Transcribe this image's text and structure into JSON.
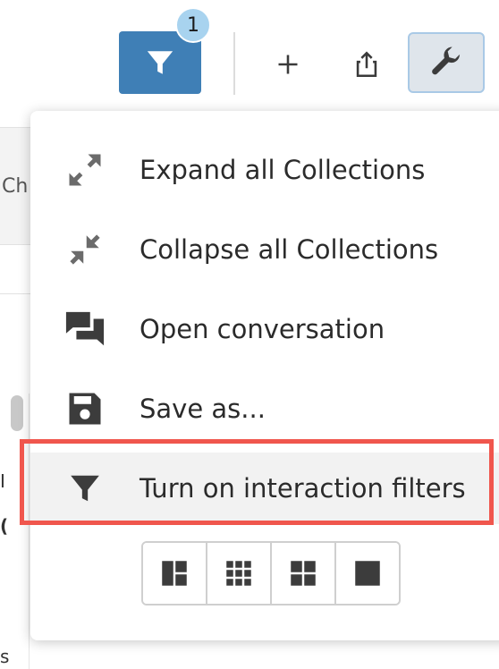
{
  "toolbar": {
    "filter_badge_count": "1",
    "filter_button_color": "#3f7fb6",
    "icons": [
      "filter-icon",
      "plus-icon",
      "share-icon",
      "wrench-icon"
    ]
  },
  "background": {
    "partial_header": "Ch",
    "fragments": [
      "I",
      "(",
      "s"
    ]
  },
  "menu": {
    "items": [
      {
        "label": "Expand all Collections",
        "icon": "expand-arrows-icon"
      },
      {
        "label": "Collapse all Collections",
        "icon": "collapse-arrows-icon"
      },
      {
        "label": "Open conversation",
        "icon": "conversation-icon"
      },
      {
        "label": "Save as...",
        "icon": "save-icon"
      },
      {
        "label": "Turn on interaction filters",
        "icon": "filter-icon",
        "highlighted": true
      }
    ],
    "layout_options": [
      "layout-sidebar-icon",
      "layout-grid-3x3-icon",
      "layout-grid-2x2-icon",
      "layout-single-icon"
    ],
    "highlight_color": "#f0564d"
  }
}
